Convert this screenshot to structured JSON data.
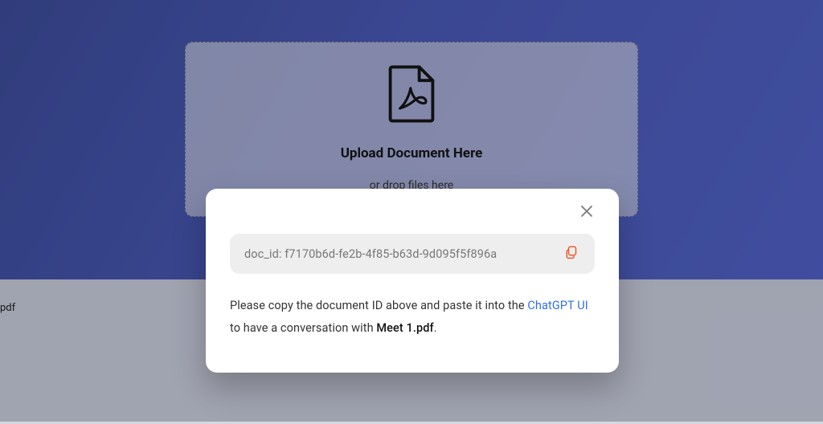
{
  "upload": {
    "title": "Upload Document Here",
    "subtitle": "or drop files here"
  },
  "left_filename_fragment": "pdf",
  "modal": {
    "doc_id_label": "doc_id: f7170b6d-fe2b-4f85-b63d-9d095f5f896a",
    "instruction_pre": "Please copy the document ID above and paste it into the ",
    "link_text": "ChatGPT UI",
    "instruction_mid": " to have a conversation with ",
    "filename": "Meet 1.pdf",
    "instruction_post": "."
  }
}
